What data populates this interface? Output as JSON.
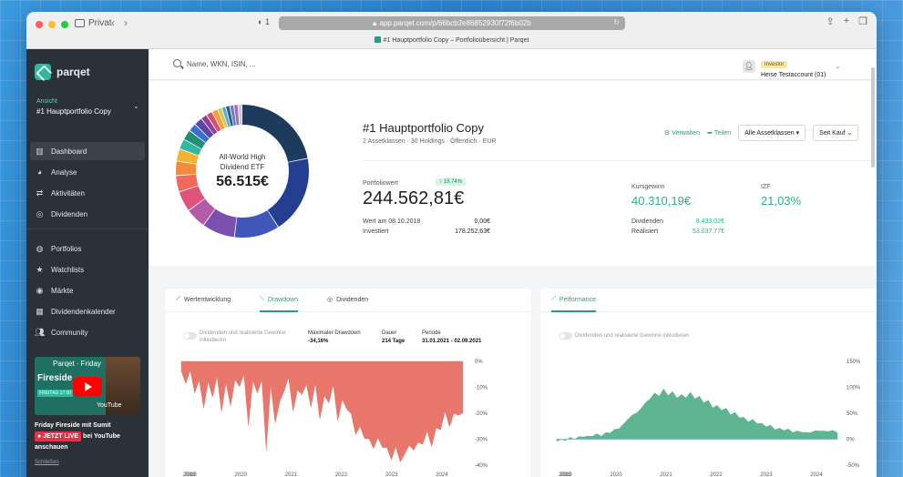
{
  "browser": {
    "sidebar_label": "Privat",
    "url": "app.parqet.com/p/66bcb2e86852930f72f6b02b",
    "tab_title": "#1 Hauptportfolio Copy – Portfolioübersicht | Parqet",
    "shield_count": "1"
  },
  "sidebar": {
    "brand": "parqet",
    "view_label": "Ansicht",
    "view_value": "#1 Hauptportfolio Copy",
    "nav_primary": [
      {
        "label": "Dashboard",
        "icon": "chart-icon",
        "active": true
      },
      {
        "label": "Analyse",
        "icon": "pie-icon"
      },
      {
        "label": "Aktivitäten",
        "icon": "transfer-icon"
      },
      {
        "label": "Dividenden",
        "icon": "coins-icon"
      }
    ],
    "nav_secondary": [
      {
        "label": "Portfolios",
        "icon": "portfolios-icon"
      },
      {
        "label": "Watchlists",
        "icon": "star-icon"
      },
      {
        "label": "Märkte",
        "icon": "globe-icon"
      },
      {
        "label": "Dividendenkalender",
        "icon": "calendar-icon"
      },
      {
        "label": "Community",
        "icon": "users-icon"
      }
    ],
    "promo": {
      "video_title": "Parqet · Friday",
      "video_caption": "Fireside",
      "video_tag": "FREITAG 17:00",
      "youtube_label": "YouTube",
      "line1": "Friday Fireside mit Sumit",
      "live": "JETZT LIVE",
      "line2": "bei YouTube",
      "line3": "anschauen",
      "close": "Schließen"
    }
  },
  "topbar": {
    "search_placeholder": "Name, WKN, ISIN, ...",
    "role": "Investor",
    "account_name": "Heise Testaccount (01)"
  },
  "portfolio": {
    "donut_label_1": "All-World High",
    "donut_label_2": "Dividend ETF",
    "donut_value": "56.515€",
    "title": "#1 Hauptportfolio Copy",
    "subtitle": "2 Assetklassen · 30 Holdings · Öffentlich · EUR",
    "manage": "Verwalten",
    "share": "Teilen",
    "asset_filter": "Alle Assetklassen",
    "since_filter": "Seit Kauf",
    "value_label": "Portfoliowert",
    "value_badge": "↑ 19,74%",
    "value": "244.562,81€",
    "date_label": "Wert am 08.10.2018",
    "date_value": "0,00€",
    "invested_label": "Investiert",
    "invested_value": "178.252,63€",
    "gain_label": "Kursgewinn",
    "gain_value": "40.310,19€",
    "izf_label": "IZF",
    "izf_value": "21,03%",
    "dividends_label": "Dividenden",
    "dividends_value": "8.433,02€",
    "realized_label": "Realisiert",
    "realized_value": "53.037,77€",
    "colors": {
      "accent": "#2a9a85",
      "green": "#2ab08a",
      "drawdown": "#e8766b",
      "performance": "#5fb592"
    }
  },
  "left_card": {
    "tabs": [
      "Wertentwicklung",
      "Drawdown",
      "Dividenden"
    ],
    "active_tab": "Drawdown",
    "toggle_label_1": "Dividenden und realisierte Gewinne",
    "toggle_label_2": "inkludieren",
    "stat_max_label": "Maximaler Drawdown",
    "stat_max_value": "-34,16%",
    "stat_duration_label": "Dauer",
    "stat_duration_value": "214 Tage",
    "stat_period_label": "Periode",
    "stat_period_value": "31.01.2021 - 02.09.2021"
  },
  "right_card": {
    "tab": "Performance",
    "toggle_label": "Dividenden und realisierte Gewinne inkludieren"
  },
  "chart_data": [
    {
      "type": "area",
      "name": "drawdown",
      "x_ticks": [
        "2019",
        "2020",
        "2021",
        "2022",
        "2023",
        "2024"
      ],
      "y_ticks": [
        "0%",
        "-10%",
        "-20%",
        "-30%",
        "-40%"
      ],
      "ylim": [
        -40,
        0
      ],
      "x_first_label": "2018",
      "values": [
        -2,
        -8,
        -4,
        -14,
        -6,
        -18,
        -9,
        -12,
        -5,
        -20,
        -10,
        -16,
        -7,
        -11,
        -3,
        -24,
        -8,
        -14,
        -6,
        -34,
        -10,
        -22,
        -15,
        -12,
        -8,
        -18,
        -11,
        -14,
        -7,
        -17,
        -9,
        -24,
        -12,
        -16,
        -10,
        -21,
        -14,
        -19,
        -22,
        -27,
        -25,
        -31,
        -28,
        -33,
        -30,
        -35,
        -32,
        -38,
        -34,
        -37,
        -35,
        -33,
        -36,
        -30,
        -32,
        -28,
        -31,
        -25,
        -27,
        -21,
        -24,
        -20,
        -22,
        -18
      ]
    },
    {
      "type": "area",
      "name": "performance",
      "x_ticks": [
        "2019",
        "2020",
        "2021",
        "2022",
        "2023",
        "2024"
      ],
      "y_ticks": [
        "150%",
        "100%",
        "50%",
        "0%",
        "-50%"
      ],
      "ylim": [
        -50,
        150
      ],
      "x_first_label": "2018",
      "values": [
        -2,
        0,
        -3,
        2,
        1,
        5,
        3,
        8,
        6,
        10,
        4,
        14,
        12,
        18,
        22,
        30,
        38,
        45,
        52,
        60,
        70,
        80,
        90,
        82,
        95,
        85,
        92,
        78,
        88,
        80,
        90,
        76,
        84,
        70,
        74,
        62,
        66,
        55,
        58,
        48,
        52,
        40,
        44,
        34,
        38,
        28,
        32,
        24,
        26,
        20,
        22,
        16,
        18,
        14,
        16,
        12,
        15,
        13,
        16,
        14,
        17,
        15,
        16,
        14
      ]
    }
  ]
}
